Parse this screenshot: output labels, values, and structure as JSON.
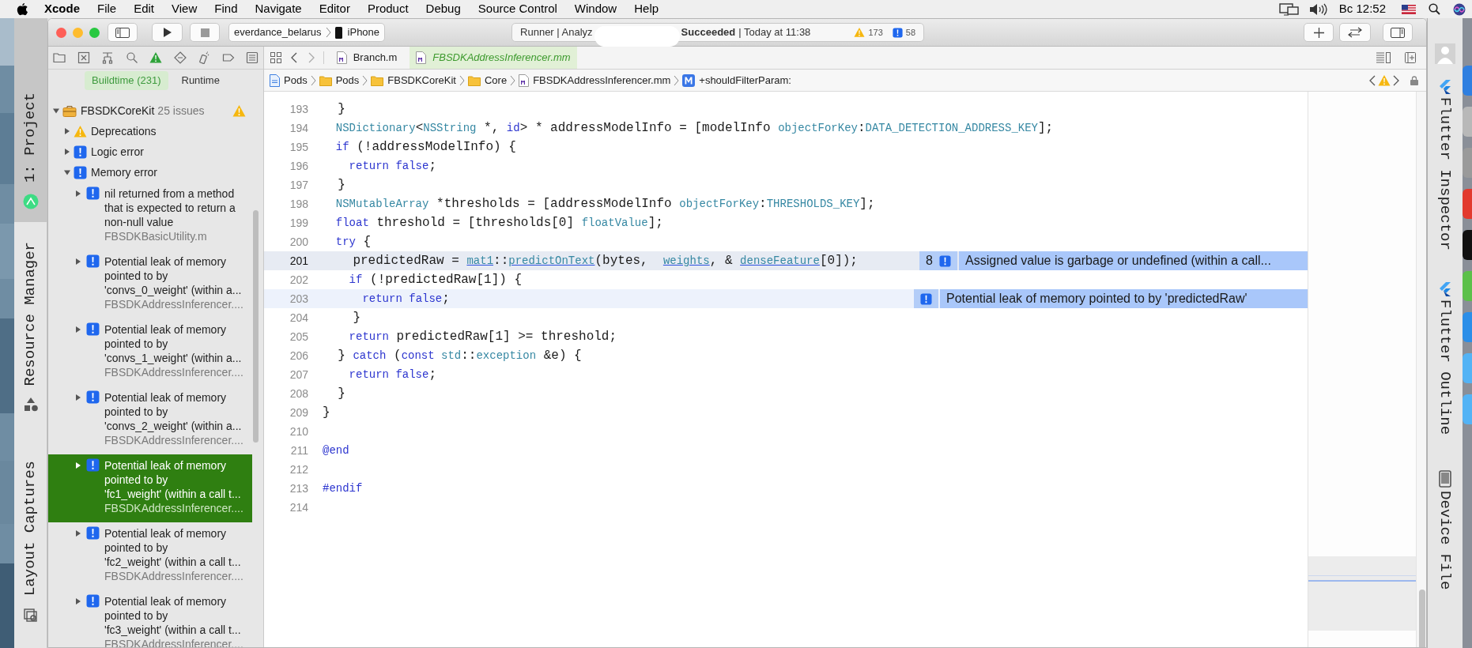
{
  "menu_bar": {
    "app": "Xcode",
    "items": [
      "File",
      "Edit",
      "View",
      "Find",
      "Navigate",
      "Editor",
      "Product",
      "Debug",
      "Source Control",
      "Window",
      "Help"
    ],
    "clock": "Вс 12:52"
  },
  "toolbar": {
    "scheme": "everdance_belarus",
    "device": "iPhone",
    "activity": {
      "project": "Runner | Analyz",
      "status": "Succeeded",
      "time": "| Today at 11:38",
      "warnings": "173",
      "errors": "58"
    }
  },
  "navigator": {
    "scope_tabs": [
      {
        "label": "Buildtime (231)",
        "selected": true
      },
      {
        "label": "Runtime",
        "selected": false
      }
    ],
    "tree": [
      {
        "kind": "target",
        "label": "FBSDKCoreKit",
        "count": "25 issues",
        "expanded": true,
        "selected": false,
        "children": [
          {
            "kind": "warning",
            "label": "Deprecations",
            "expanded": false,
            "selected": false
          },
          {
            "kind": "error",
            "label": "Logic error",
            "expanded": false,
            "selected": false
          },
          {
            "kind": "error",
            "label": "Memory error",
            "expanded": true,
            "selected": false,
            "children": [
              {
                "kind": "issue",
                "lines": [
                  "nil returned from a method",
                  "that is expected to return a",
                  "non-null value"
                ],
                "file": "FBSDKBasicUtility.m",
                "expanded": false,
                "selected": false
              },
              {
                "kind": "issue",
                "lines": [
                  "Potential leak of memory",
                  "pointed to by",
                  "'convs_0_weight' (within a..."
                ],
                "file": "FBSDKAddressInferencer....",
                "expanded": false,
                "selected": false
              },
              {
                "kind": "issue",
                "lines": [
                  "Potential leak of memory",
                  "pointed to by",
                  "'convs_1_weight' (within a..."
                ],
                "file": "FBSDKAddressInferencer....",
                "expanded": false,
                "selected": false
              },
              {
                "kind": "issue",
                "lines": [
                  "Potential leak of memory",
                  "pointed to by",
                  "'convs_2_weight' (within a..."
                ],
                "file": "FBSDKAddressInferencer....",
                "expanded": false,
                "selected": false
              },
              {
                "kind": "issue",
                "lines": [
                  "Potential leak of memory",
                  "pointed to by",
                  "'fc1_weight' (within a call t..."
                ],
                "file": "FBSDKAddressInferencer....",
                "expanded": false,
                "selected": true
              },
              {
                "kind": "issue",
                "lines": [
                  "Potential leak of memory",
                  "pointed to by",
                  "'fc2_weight' (within a call t..."
                ],
                "file": "FBSDKAddressInferencer....",
                "expanded": false,
                "selected": false
              },
              {
                "kind": "issue",
                "lines": [
                  "Potential leak of memory",
                  "pointed to by",
                  "'fc3_weight' (within a call t..."
                ],
                "file": "FBSDKAddressInferencer....",
                "expanded": false,
                "selected": false
              }
            ]
          }
        ]
      }
    ]
  },
  "editor_tabs": [
    {
      "label": "Branch.m",
      "selected": false
    },
    {
      "label": "FBSDKAddressInferencer.mm",
      "selected": true
    }
  ],
  "breadcrumbs": [
    {
      "kind": "project",
      "label": "Pods"
    },
    {
      "kind": "folder",
      "label": "Pods"
    },
    {
      "kind": "folder",
      "label": "FBSDKCoreKit"
    },
    {
      "kind": "folder",
      "label": "Core"
    },
    {
      "kind": "file",
      "label": "FBSDKAddressInferencer.mm"
    },
    {
      "kind": "method",
      "label": "+shouldFilterParam:"
    }
  ],
  "code": {
    "lines": [
      {
        "number": "193",
        "selected": false,
        "flagged": false,
        "tokens": [
          {
            "text": "  }",
            "kind": "plain"
          }
        ]
      },
      {
        "number": "194",
        "selected": false,
        "flagged": false,
        "tokens": [
          {
            "text": "  NSDictionary",
            "kind": "type"
          },
          {
            "text": "<",
            "kind": "plain"
          },
          {
            "text": "NSString",
            "kind": "type"
          },
          {
            "text": " *, ",
            "kind": "plain"
          },
          {
            "text": "id",
            "kind": "keyword"
          },
          {
            "text": "> * addressModelInfo = [modelInfo ",
            "kind": "plain"
          },
          {
            "text": "objectForKey",
            "kind": "type"
          },
          {
            "text": ":",
            "kind": "plain"
          },
          {
            "text": "DATA_DETECTION_ADDRESS_KEY",
            "kind": "type"
          },
          {
            "text": "];",
            "kind": "plain"
          }
        ]
      },
      {
        "number": "195",
        "selected": false,
        "flagged": false,
        "tokens": [
          {
            "text": "  if",
            "kind": "keyword"
          },
          {
            "text": " (!addressModelInfo) {",
            "kind": "plain"
          }
        ]
      },
      {
        "number": "196",
        "selected": false,
        "flagged": false,
        "tokens": [
          {
            "text": "    return",
            "kind": "keyword"
          },
          {
            "text": " false",
            "kind": "keyword"
          },
          {
            "text": ";",
            "kind": "plain"
          }
        ]
      },
      {
        "number": "197",
        "selected": false,
        "flagged": false,
        "tokens": [
          {
            "text": "  }",
            "kind": "plain"
          }
        ]
      },
      {
        "number": "198",
        "selected": false,
        "flagged": false,
        "tokens": [
          {
            "text": "  NSMutableArray",
            "kind": "type"
          },
          {
            "text": " *thresholds = [addressModelInfo ",
            "kind": "plain"
          },
          {
            "text": "objectForKey",
            "kind": "type"
          },
          {
            "text": ":",
            "kind": "plain"
          },
          {
            "text": "THRESHOLDS_KEY",
            "kind": "type"
          },
          {
            "text": "];",
            "kind": "plain"
          }
        ]
      },
      {
        "number": "199",
        "selected": false,
        "flagged": false,
        "tokens": [
          {
            "text": "  float",
            "kind": "keyword"
          },
          {
            "text": " threshold = [thresholds[0] ",
            "kind": "plain"
          },
          {
            "text": "floatValue",
            "kind": "type"
          },
          {
            "text": "];",
            "kind": "plain"
          }
        ]
      },
      {
        "number": "200",
        "selected": false,
        "flagged": false,
        "tokens": [
          {
            "text": "  try",
            "kind": "keyword"
          },
          {
            "text": " {",
            "kind": "plain"
          }
        ]
      },
      {
        "number": "201",
        "selected": true,
        "flagged": false,
        "tokens": [
          {
            "text": "    predictedRaw = ",
            "kind": "plain"
          },
          {
            "text": "mat1",
            "kind": "link"
          },
          {
            "text": "::",
            "kind": "plain"
          },
          {
            "text": "predictOnText",
            "kind": "link"
          },
          {
            "text": "(bytes,  ",
            "kind": "plain"
          },
          {
            "text": "weights",
            "kind": "link"
          },
          {
            "text": ", & ",
            "kind": "plain"
          },
          {
            "text": "denseFeature",
            "kind": "link"
          },
          {
            "text": "[0]);",
            "kind": "plain"
          }
        ],
        "annotation": {
          "count": "8",
          "message": "Assigned value is garbage or undefined (within a call..."
        }
      },
      {
        "number": "202",
        "selected": false,
        "flagged": false,
        "tokens": [
          {
            "text": "    if",
            "kind": "keyword"
          },
          {
            "text": " (!predictedRaw[1]) {",
            "kind": "plain"
          }
        ]
      },
      {
        "number": "203",
        "selected": false,
        "flagged": true,
        "tokens": [
          {
            "text": "      return",
            "kind": "keyword"
          },
          {
            "text": " false",
            "kind": "keyword"
          },
          {
            "text": ";",
            "kind": "plain"
          }
        ],
        "annotation": {
          "message": "Potential leak of memory pointed to by 'predictedRaw'"
        }
      },
      {
        "number": "204",
        "selected": false,
        "flagged": false,
        "tokens": [
          {
            "text": "    }",
            "kind": "plain"
          }
        ]
      },
      {
        "number": "205",
        "selected": false,
        "flagged": false,
        "tokens": [
          {
            "text": "    return",
            "kind": "keyword"
          },
          {
            "text": " predictedRaw[1] >= threshold;",
            "kind": "plain"
          }
        ]
      },
      {
        "number": "206",
        "selected": false,
        "flagged": false,
        "tokens": [
          {
            "text": "  } ",
            "kind": "plain"
          },
          {
            "text": "catch",
            "kind": "keyword"
          },
          {
            "text": " (",
            "kind": "plain"
          },
          {
            "text": "const",
            "kind": "keyword"
          },
          {
            "text": " std",
            "kind": "type"
          },
          {
            "text": "::",
            "kind": "plain"
          },
          {
            "text": "exception",
            "kind": "type"
          },
          {
            "text": " &e) {",
            "kind": "plain"
          }
        ]
      },
      {
        "number": "207",
        "selected": false,
        "flagged": false,
        "tokens": [
          {
            "text": "    return",
            "kind": "keyword"
          },
          {
            "text": " false",
            "kind": "keyword"
          },
          {
            "text": ";",
            "kind": "plain"
          }
        ]
      },
      {
        "number": "208",
        "selected": false,
        "flagged": false,
        "tokens": [
          {
            "text": "  }",
            "kind": "plain"
          }
        ]
      },
      {
        "number": "209",
        "selected": false,
        "flagged": false,
        "tokens": [
          {
            "text": "}",
            "kind": "plain"
          }
        ]
      },
      {
        "number": "210",
        "selected": false,
        "flagged": false
      },
      {
        "number": "211",
        "selected": false,
        "flagged": false,
        "tokens": [
          {
            "text": "@end",
            "kind": "directive"
          }
        ]
      },
      {
        "number": "212",
        "selected": false,
        "flagged": false
      },
      {
        "number": "213",
        "selected": false,
        "flagged": false,
        "tokens": [
          {
            "text": "#endif",
            "kind": "directive"
          }
        ]
      },
      {
        "number": "214",
        "selected": false,
        "flagged": false
      }
    ]
  },
  "side_tabs_left": [
    {
      "label": "1: Project",
      "selected": true
    },
    {
      "label": "Resource Manager",
      "selected": false
    },
    {
      "label": "Layout Captures",
      "selected": false
    }
  ],
  "side_tabs_right": [
    {
      "label": "Flutter Inspector"
    },
    {
      "label": "Flutter Outline"
    },
    {
      "label": "Device File"
    }
  ]
}
